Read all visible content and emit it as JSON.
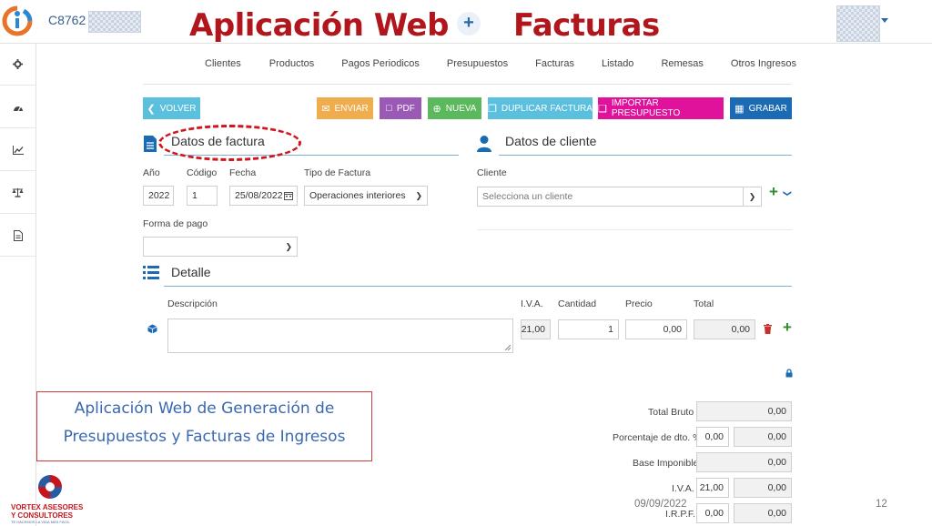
{
  "header": {
    "code": "C8762 -",
    "title_left": "Aplicación Web",
    "title_right": "Facturas",
    "plus": "+"
  },
  "icons": {
    "sidebar": [
      "gear-icon",
      "dashboard-icon",
      "chart-icon",
      "balance-icon",
      "document-icon"
    ]
  },
  "nav": {
    "items": [
      "Clientes",
      "Productos",
      "Pagos Periodicos",
      "Presupuestos",
      "Facturas",
      "Listado",
      "Remesas",
      "Otros Ingresos"
    ]
  },
  "actions": {
    "volver": "VOLVER",
    "enviar": "ENVIAR",
    "pdf": "PDF",
    "nueva": "NUEVA",
    "duplicar": "DUPLICAR FACTURA",
    "importar": "IMPORTAR PRESUPUESTO",
    "grabar": "GRABAR"
  },
  "colors": {
    "volver": "#5bc0de",
    "enviar": "#f0ad4e",
    "pdf": "#9b59b6",
    "nueva": "#5cb85c",
    "duplicar": "#5bc0de",
    "importar": "#e0119a",
    "grabar": "#1a6bb3",
    "title_red": "#b0161c"
  },
  "factura": {
    "title": "Datos de factura",
    "ano_label": "Año",
    "ano_value": "2022",
    "codigo_label": "Código",
    "codigo_value": "1",
    "fecha_label": "Fecha",
    "fecha_value": "25/08/2022",
    "tipo_label": "Tipo de Factura",
    "tipo_value": "Operaciones interiores",
    "forma_pago_label": "Forma de pago",
    "forma_pago_value": ""
  },
  "cliente": {
    "title": "Datos de cliente",
    "label": "Cliente",
    "placeholder": "Selecciona un cliente"
  },
  "detalle": {
    "title": "Detalle",
    "headers": {
      "descripcion": "Descripción",
      "iva": "I.V.A.",
      "cantidad": "Cantidad",
      "precio": "Precio",
      "total": "Total"
    },
    "row": {
      "descripcion": "",
      "iva": "21,00",
      "cantidad": "1",
      "precio": "0,00",
      "total": "0,00"
    }
  },
  "totales": {
    "total_bruto_label": "Total Bruto",
    "total_bruto": "0,00",
    "dto_label": "Porcentaje de dto. %",
    "dto_pct": "0,00",
    "dto_value": "0,00",
    "base_label": "Base Imponible",
    "base": "0,00",
    "iva_label": "I.V.A.",
    "iva_pct": "21,00",
    "iva_value": "0,00",
    "irpf_label": "I.R.P.F.",
    "irpf_pct": "0,00",
    "irpf_value": "0,00"
  },
  "caption": {
    "line1": "Aplicación Web de Generación de",
    "line2": "Presupuestos y Facturas de Ingresos"
  },
  "footer": {
    "date": "09/09/2022",
    "page": "12",
    "brand_line1": "VORTEX ASESORES",
    "brand_line2": "Y CONSULTORES",
    "brand_tag": "TE HACEMOS LA VIDA MÁS FÁCIL"
  }
}
